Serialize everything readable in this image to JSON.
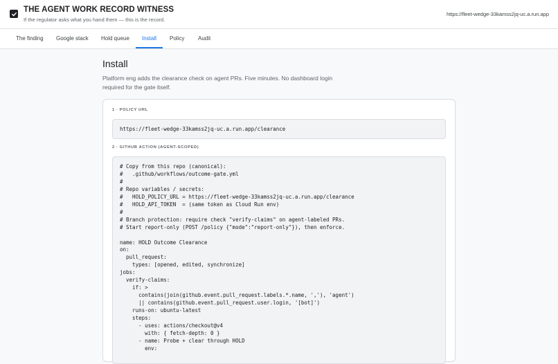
{
  "header": {
    "title": "THE AGENT WORK RECORD WITNESS",
    "subtitle": "If the regulator asks what you hand them — this is the record.",
    "url": "https://fleet-wedge-33kamss2jq-uc.a.run.app"
  },
  "tabs": [
    {
      "label": "The finding"
    },
    {
      "label": "Google stack"
    },
    {
      "label": "Hold queue"
    },
    {
      "label": "Install",
      "active": true
    },
    {
      "label": "Policy"
    },
    {
      "label": "Audit"
    }
  ],
  "main": {
    "title": "Install",
    "description": "Platform eng adds the clearance check on agent PRs. Five minutes. No dashboard login required for the gate itself.",
    "steps": [
      {
        "label": "1 · POLICY URL",
        "code": "https://fleet-wedge-33kamss2jq-uc.a.run.app/clearance"
      },
      {
        "label": "2 · GITHUB ACTION (AGENT-SCOPED)",
        "code": "# Copy from this repo (canonical):\n#   .github/workflows/outcome-gate.yml\n#\n# Repo variables / secrets:\n#   HOLD_POLICY_URL = https://fleet-wedge-33kamss2jq-uc.a.run.app/clearance\n#   HOLD_API_TOKEN  = (same token as Cloud Run env)\n#\n# Branch protection: require check \"verify-claims\" on agent-labeled PRs.\n# Start report-only (POST /policy {\"mode\":\"report-only\"}), then enforce.\n\nname: HOLD Outcome Clearance\non:\n  pull_request:\n    types: [opened, edited, synchronize]\njobs:\n  verify-claims:\n    if: >\n      contains(join(github.event.pull_request.labels.*.name, ','), 'agent')\n      || contains(github.event.pull_request.user.login, '[bot]')\n    runs-on: ubuntu-latest\n    steps:\n      - uses: actions/checkout@v4\n        with: { fetch-depth: 0 }\n      - name: Probe + clear through HOLD\n        env:"
      }
    ]
  },
  "colors": {
    "accent": "#1a73e8",
    "text": "#202124",
    "muted": "#5f6368",
    "background": "#f8f9fa"
  },
  "icons": {
    "logo": "checkbox-check-icon"
  }
}
